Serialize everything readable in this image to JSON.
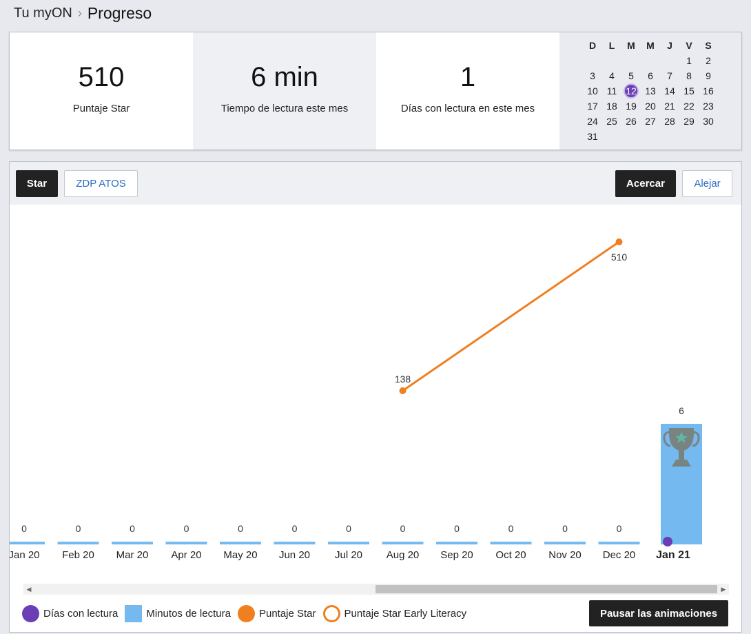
{
  "breadcrumb": {
    "parent": "Tu myON",
    "current": "Progreso"
  },
  "stats": [
    {
      "value": "510",
      "label": "Puntaje Star"
    },
    {
      "value": "6 min",
      "label": "Tiempo de lectura este mes"
    },
    {
      "value": "1",
      "label": "Días con lectura en este mes"
    }
  ],
  "calendar": {
    "weekdays": [
      "D",
      "L",
      "M",
      "M",
      "J",
      "V",
      "S"
    ],
    "start_weekday_index": 5,
    "days_in_month": 31,
    "today": 12,
    "today_color": "#6b3fb5"
  },
  "toolbar": {
    "star": "Star",
    "zdp": "ZDP ATOS",
    "zoom_in": "Acercar",
    "zoom_out": "Alejar"
  },
  "chart_data": {
    "type": "bar",
    "categories": [
      "Jan 20",
      "Feb 20",
      "Mar 20",
      "Apr 20",
      "May 20",
      "Jun 20",
      "Jul 20",
      "Aug 20",
      "Sep 20",
      "Oct 20",
      "Nov 20",
      "Dec 20",
      "Jan 21"
    ],
    "series": [
      {
        "name": "Minutos de lectura",
        "type": "bar",
        "values": [
          0,
          0,
          0,
          0,
          0,
          0,
          0,
          0,
          0,
          0,
          0,
          0,
          6
        ],
        "color": "#74b9f0"
      },
      {
        "name": "Puntaje Star",
        "type": "line",
        "points": [
          {
            "category": "Aug 20",
            "value": 138
          },
          {
            "category": "Dec 20",
            "value": 510
          }
        ],
        "color": "#f07f1f"
      },
      {
        "name": "Días con lectura",
        "type": "marker",
        "points": [
          {
            "category": "Jan 21",
            "value": 0
          }
        ],
        "color": "#6a3eb6"
      }
    ],
    "highlight_category": "Jan 21",
    "award_icon": "trophy-icon",
    "legend_position": "bottom-left"
  },
  "legend": [
    {
      "label": "Días con lectura",
      "icon": "purple-dot"
    },
    {
      "label": "Minutos de lectura",
      "icon": "blue-square"
    },
    {
      "label": "Puntaje Star",
      "icon": "orange-dot"
    },
    {
      "label": "Puntaje Star Early Literacy",
      "icon": "orange-ring"
    }
  ],
  "pause_button": "Pausar las animaciones"
}
